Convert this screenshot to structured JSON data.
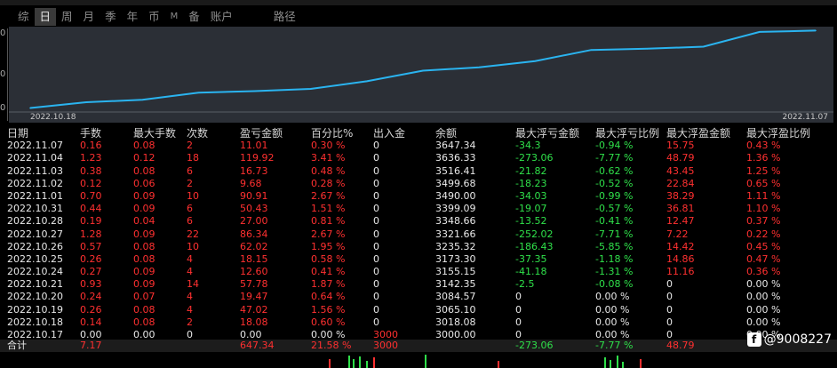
{
  "tabs": [
    {
      "label": "综",
      "active": false
    },
    {
      "label": "日",
      "active": true
    },
    {
      "label": "周",
      "active": false
    },
    {
      "label": "月",
      "active": false
    },
    {
      "label": "季",
      "active": false
    },
    {
      "label": "年",
      "active": false
    },
    {
      "label": "币",
      "active": false
    },
    {
      "label": "M",
      "active": false
    },
    {
      "label": "备",
      "active": false
    },
    {
      "label": "账户",
      "active": false
    },
    {
      "label": "路径",
      "active": false
    }
  ],
  "chart": {
    "start_date": "2022.10.18",
    "end_date": "2022.11.07",
    "line_color": "#2ab4f0",
    "background": "#2b2f36"
  },
  "chart_data": {
    "type": "line",
    "x": [
      "2022.10.18",
      "2022.10.19",
      "2022.10.20",
      "2022.10.21",
      "2022.10.24",
      "2022.10.25",
      "2022.10.26",
      "2022.10.27",
      "2022.10.28",
      "2022.10.31",
      "2022.11.01",
      "2022.11.02",
      "2022.11.03",
      "2022.11.04",
      "2022.11.07"
    ],
    "values": [
      3018.08,
      3065.1,
      3084.57,
      3142.35,
      3155.15,
      3173.3,
      3235.32,
      3321.66,
      3348.66,
      3399.09,
      3490.0,
      3499.68,
      3516.41,
      3636.33,
      3647.34
    ],
    "xlabel": "",
    "ylabel": ""
  },
  "table": {
    "headers": [
      "日期",
      "手数",
      "最大手数",
      "次数",
      "盈亏金额",
      "百分比%",
      "出入金",
      "余额",
      "最大浮亏金额",
      "最大浮亏比例",
      "最大浮盈金额",
      "最大浮盈比例"
    ],
    "rows": [
      [
        "2022.11.07",
        "0.16",
        "0.08",
        "2",
        "11.01",
        "0.30 %",
        "0",
        "3647.34",
        "-34.3",
        "-0.94 %",
        "15.75",
        "0.43 %"
      ],
      [
        "2022.11.04",
        "1.23",
        "0.12",
        "18",
        "119.92",
        "3.41 %",
        "0",
        "3636.33",
        "-273.06",
        "-7.77 %",
        "48.79",
        "1.36 %"
      ],
      [
        "2022.11.03",
        "0.38",
        "0.08",
        "6",
        "16.73",
        "0.48 %",
        "0",
        "3516.41",
        "-21.82",
        "-0.62 %",
        "43.45",
        "1.25 %"
      ],
      [
        "2022.11.02",
        "0.12",
        "0.06",
        "2",
        "9.68",
        "0.28 %",
        "0",
        "3499.68",
        "-18.23",
        "-0.52 %",
        "22.84",
        "0.65 %"
      ],
      [
        "2022.11.01",
        "0.70",
        "0.09",
        "10",
        "90.91",
        "2.67 %",
        "0",
        "3490.00",
        "-34.03",
        "-0.99 %",
        "38.29",
        "1.11 %"
      ],
      [
        "2022.10.31",
        "0.44",
        "0.09",
        "6",
        "50.43",
        "1.51 %",
        "0",
        "3399.09",
        "-19.07",
        "-0.57 %",
        "36.81",
        "1.10 %"
      ],
      [
        "2022.10.28",
        "0.19",
        "0.04",
        "6",
        "27.00",
        "0.81 %",
        "0",
        "3348.66",
        "-13.52",
        "-0.41 %",
        "12.47",
        "0.37 %"
      ],
      [
        "2022.10.27",
        "1.28",
        "0.09",
        "22",
        "86.34",
        "2.67 %",
        "0",
        "3321.66",
        "-252.02",
        "-7.71 %",
        "7.22",
        "0.22 %"
      ],
      [
        "2022.10.26",
        "0.57",
        "0.08",
        "10",
        "62.02",
        "1.95 %",
        "0",
        "3235.32",
        "-186.43",
        "-5.85 %",
        "14.42",
        "0.45 %"
      ],
      [
        "2022.10.25",
        "0.26",
        "0.08",
        "4",
        "18.15",
        "0.58 %",
        "0",
        "3173.30",
        "-37.35",
        "-1.18 %",
        "14.86",
        "0.47 %"
      ],
      [
        "2022.10.24",
        "0.27",
        "0.09",
        "4",
        "12.60",
        "0.41 %",
        "0",
        "3155.15",
        "-41.18",
        "-1.31 %",
        "11.16",
        "0.36 %"
      ],
      [
        "2022.10.21",
        "0.93",
        "0.09",
        "14",
        "57.78",
        "1.87 %",
        "0",
        "3142.35",
        "-2.5",
        "-0.08 %",
        "0",
        "0.00 %"
      ],
      [
        "2022.10.20",
        "0.24",
        "0.07",
        "4",
        "19.47",
        "0.64 %",
        "0",
        "3084.57",
        "0",
        "0.00 %",
        "0",
        "0.00 %"
      ],
      [
        "2022.10.19",
        "0.26",
        "0.08",
        "4",
        "47.02",
        "1.56 %",
        "0",
        "3065.10",
        "0",
        "0.00 %",
        "0",
        "0.00 %"
      ],
      [
        "2022.10.18",
        "0.14",
        "0.08",
        "2",
        "18.08",
        "0.60 %",
        "0",
        "3018.08",
        "0",
        "0.00 %",
        "0",
        "0.00 %"
      ],
      [
        "2022.10.17",
        "0.00",
        "0.00",
        "0",
        "0.00",
        "0.00 %",
        "3000",
        "3000.00",
        "0",
        "0.00 %",
        "0",
        "0.00 %"
      ]
    ],
    "totals": {
      "label": "合计",
      "lots": "7.17",
      "profit": "647.34",
      "percent": "21.58 %",
      "deposit": "3000",
      "max_float_loss": "-273.06",
      "max_float_loss_pct": "-7.77 %",
      "max_float_profit": "48.79"
    }
  },
  "watermark": "@9008227",
  "colors": {
    "positive": "#ff3030",
    "negative": "#2fe04a",
    "neutral": "#e8e8e8"
  }
}
